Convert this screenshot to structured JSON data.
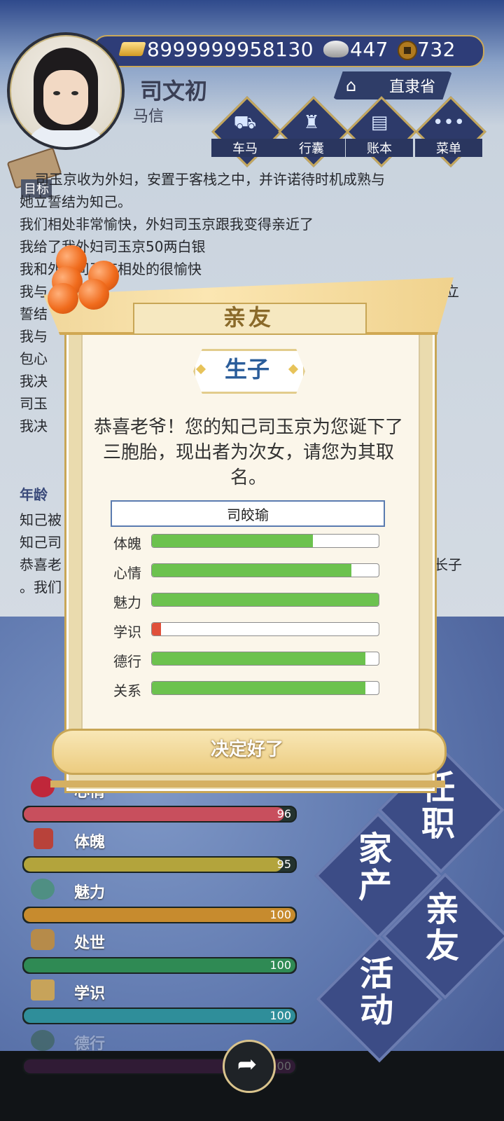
{
  "header": {
    "player_name": "司文初",
    "player_title": "马信",
    "location": "直隶省",
    "currency": {
      "gold": "8999999958130",
      "silver": "447",
      "coins": "732"
    }
  },
  "nav": [
    {
      "label": "车马",
      "icon": "carriage-icon"
    },
    {
      "label": "行囊",
      "icon": "bag-icon"
    },
    {
      "label": "账本",
      "icon": "ledger-icon"
    },
    {
      "label": "菜单",
      "icon": "more-icon"
    }
  ],
  "goal": {
    "label": "目标"
  },
  "log": {
    "lines": [
      "司玉京收为外妇，安置于客栈之中，并许诺待时机成熟与",
      "她立誓结为知己。",
      "我们相处非常愉快，外妇司玉京跟我变得亲近了",
      "我给了我外妇司玉京50两白银",
      "我和外妇司玉京相处的很愉快",
      "我与",
      "誓结",
      "我与",
      "包心",
      "我决",
      "司玉",
      "我决"
    ],
    "right_fragments": [
      "立",
      "长子"
    ],
    "age_line": "年龄",
    "lines2": [
      "知己被",
      "知己司",
      "恭喜老",
      "。我们"
    ]
  },
  "modal": {
    "heading": "亲友",
    "event_title": "生子",
    "message": "恭喜老爷！您的知己司玉京为您诞下了三胞胎，现出者为次女，请您为其取名。",
    "name_value": "司皎瑜",
    "stats": [
      {
        "label": "体魄",
        "fill": 0.71,
        "color": "#6cc24e"
      },
      {
        "label": "心情",
        "fill": 0.88,
        "color": "#6cc24e"
      },
      {
        "label": "魅力",
        "fill": 1.0,
        "color": "#6cc24e"
      },
      {
        "label": "学识",
        "fill": 0.04,
        "color": "#e0503a"
      },
      {
        "label": "德行",
        "fill": 0.94,
        "color": "#6cc24e"
      },
      {
        "label": "关系",
        "fill": 0.94,
        "color": "#6cc24e"
      }
    ],
    "confirm_label": "决定好了"
  },
  "bottom_stats": [
    {
      "label": "心情",
      "value": "96",
      "fill": 0.96,
      "color": "#c84f5d",
      "icon": "flower-icon",
      "icon_color": "#c0273a"
    },
    {
      "label": "体魄",
      "value": "95",
      "fill": 0.95,
      "color": "#b3a43c",
      "icon": "vase-icon",
      "icon_color": "#b8423a"
    },
    {
      "label": "魅力",
      "value": "100",
      "fill": 1.0,
      "color": "#c78b2e",
      "icon": "mirror-icon",
      "icon_color": "#4f8f83"
    },
    {
      "label": "处世",
      "value": "100",
      "fill": 1.0,
      "color": "#2f8a54",
      "icon": "abacus-icon",
      "icon_color": "#b68b4a"
    },
    {
      "label": "学识",
      "value": "100",
      "fill": 1.0,
      "color": "#2f8e9a",
      "icon": "books-icon",
      "icon_color": "#c7a35a"
    },
    {
      "label": "德行",
      "value": "100",
      "fill": 1.0,
      "color": "#6b2a6e",
      "icon": "bowl-icon",
      "icon_color": "#2f5b3a"
    }
  ],
  "side_menu": {
    "office": "任职",
    "estate": "家产",
    "family": "亲友",
    "activity": "活动"
  }
}
